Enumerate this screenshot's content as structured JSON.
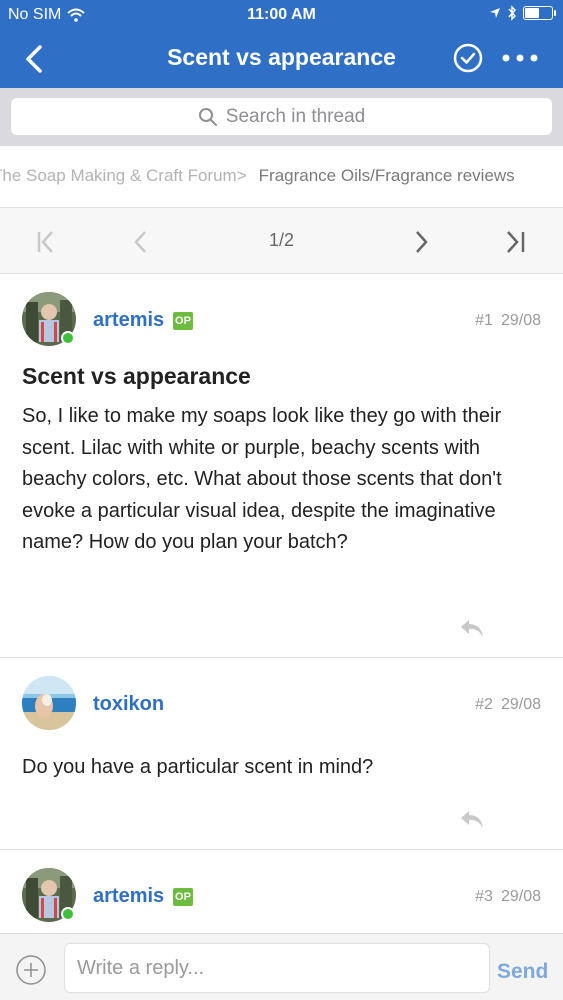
{
  "status_bar": {
    "carrier": "No SIM",
    "time": "11:00 AM",
    "battery_level": 0.55
  },
  "nav": {
    "title": "Scent vs appearance"
  },
  "search": {
    "placeholder": "Search in thread"
  },
  "breadcrumb": {
    "parent": "The Soap Making & Craft Forum",
    "separator": ">",
    "current": "Fragrance Oils/Fragrance reviews"
  },
  "pagination": {
    "indicator": "1/2"
  },
  "posts": [
    {
      "username": "artemis",
      "badge": "OP",
      "number": "#1",
      "date": "29/08",
      "title": "Scent vs appearance",
      "body": "So, I like to make my soaps look like they go with their scent. Lilac with white or purple, beachy scents with beachy colors, etc. What about those scents that don't evoke a particular visual idea, despite the imaginative name? How do you plan your batch?",
      "online": true
    },
    {
      "username": "toxikon",
      "number": "#2",
      "date": "29/08",
      "body": "Do you have a particular scent in mind?",
      "online": false
    },
    {
      "username": "artemis",
      "badge": "OP",
      "number": "#3",
      "date": "29/08",
      "online": true
    }
  ],
  "reply_bar": {
    "placeholder": "Write a reply...",
    "send_label": "Send"
  },
  "colors": {
    "primary": "#2f6fc6",
    "op_badge": "#6dbb3f",
    "online": "#3cbf3c"
  }
}
